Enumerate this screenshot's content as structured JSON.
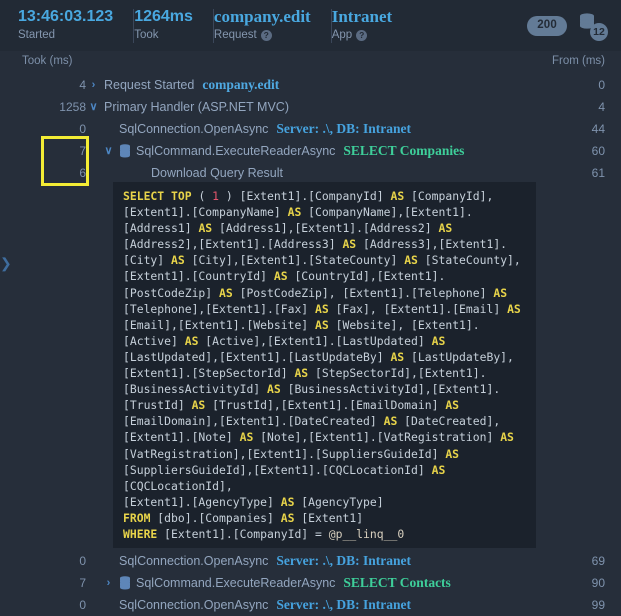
{
  "header": {
    "groups": [
      {
        "value": "13:46:03.123",
        "label": "Started",
        "serif": false,
        "help": false
      },
      {
        "value": "1264ms",
        "label": "Took",
        "serif": false,
        "help": false
      },
      {
        "value": "company.edit",
        "label": "Request",
        "serif": true,
        "help": true
      },
      {
        "value": "Intranet",
        "label": "App",
        "serif": true,
        "help": true
      }
    ],
    "status_code": "200",
    "db_count": "12",
    "help_glyph": "?",
    "icons": {
      "database_stack": "database-stack-icon",
      "help": "help-circle-icon"
    }
  },
  "columns": {
    "took_header": "Took (ms)",
    "from_header": "From (ms)"
  },
  "rows": [
    {
      "took": "4",
      "indent": 88,
      "chevron": "›",
      "has_chevron": true,
      "db_icon": false,
      "label": "Request Started",
      "detail": "company.edit",
      "detail_style": "link",
      "from": "0"
    },
    {
      "took": "1258",
      "indent": 88,
      "chevron": "∨",
      "has_chevron": true,
      "db_icon": false,
      "label": "Primary Handler (ASP.NET MVC)",
      "detail": "",
      "detail_style": "none",
      "from": "4"
    },
    {
      "took": "0",
      "indent": 103,
      "chevron": "",
      "has_chevron": false,
      "db_icon": false,
      "label": "SqlConnection.OpenAsync",
      "detail": "Server: .\\, DB: Intranet",
      "detail_style": "blue",
      "from": "44"
    },
    {
      "took": "7",
      "indent": 103,
      "chevron": "∨",
      "has_chevron": true,
      "db_icon": true,
      "label": "SqlCommand.ExecuteReaderAsync",
      "detail": "SELECT Companies",
      "detail_style": "teal",
      "from": "60"
    },
    {
      "took": "6",
      "indent": 135,
      "chevron": "",
      "has_chevron": false,
      "db_icon": false,
      "label": "Download Query Result",
      "detail": "",
      "detail_style": "none",
      "from": "61"
    }
  ],
  "rows_bottom": [
    {
      "took": "0",
      "indent": 103,
      "chevron": "",
      "has_chevron": false,
      "db_icon": false,
      "label": "SqlConnection.OpenAsync",
      "detail": "Server: .\\, DB: Intranet",
      "detail_style": "blue",
      "from": "69"
    },
    {
      "took": "7",
      "indent": 103,
      "chevron": "›",
      "has_chevron": true,
      "db_icon": true,
      "label": "SqlCommand.ExecuteReaderAsync",
      "detail": "SELECT Contacts",
      "detail_style": "teal",
      "from": "90"
    },
    {
      "took": "0",
      "indent": 103,
      "chevron": "",
      "has_chevron": false,
      "db_icon": false,
      "label": "SqlConnection.OpenAsync",
      "detail": "Server: .\\, DB: Intranet",
      "detail_style": "blue",
      "from": "99"
    }
  ],
  "sql": {
    "language": "sql",
    "keywords": [
      "SELECT",
      "TOP",
      "AS",
      "FROM",
      "WHERE"
    ],
    "text": "SELECT TOP ( 1 ) [Extent1].[CompanyId] AS [CompanyId], [Extent1].[CompanyName] AS [CompanyName],[Extent1].[Address1] AS [Address1],[Extent1].[Address2] AS [Address2],[Extent1].[Address3] AS [Address3],[Extent1].[City] AS [City],[Extent1].[StateCounty] AS [StateCounty],[Extent1].[CountryId] AS [CountryId],[Extent1].[PostCodeZip] AS [PostCodeZip], [Extent1].[Telephone] AS [Telephone],[Extent1].[Fax] AS [Fax], [Extent1].[Email] AS [Email],[Extent1].[Website] AS [Website], [Extent1].[Active] AS [Active],[Extent1].[LastUpdated] AS [LastUpdated],[Extent1].[LastUpdateBy] AS [LastUpdateBy], [Extent1].[StepSectorId] AS [StepSectorId],[Extent1].[BusinessActivityId] AS [BusinessActivityId],[Extent1].[TrustId] AS [TrustId],[Extent1].[EmailDomain] AS [EmailDomain],[Extent1].[DateCreated] AS [DateCreated],[Extent1].[Note] AS [Note],[Extent1].[VatRegistration] AS [VatRegistration],[Extent1].[SuppliersGuideId] AS [SuppliersGuideId],[Extent1].[CQCLocationId] AS [CQCLocationId],\n[Extent1].[AgencyType] AS [AgencyType]\nFROM [dbo].[Companies] AS [Extent1]\nWHERE [Extent1].[CompanyId] = @p__linq__0"
  },
  "annotation": {
    "highlight_color": "#f3ec35",
    "highlight_target": "took-values-7-and-6"
  },
  "edge_handle_glyph": "❯",
  "colors": {
    "page_bg": "#262e3a",
    "header_bg": "#222a35",
    "code_bg": "#1b222c",
    "accent_blue": "#49a8e0",
    "accent_teal": "#3ecf9a",
    "muted": "#8496ae",
    "keyword_yellow": "#e8d44a",
    "number_red": "#e5556c"
  }
}
